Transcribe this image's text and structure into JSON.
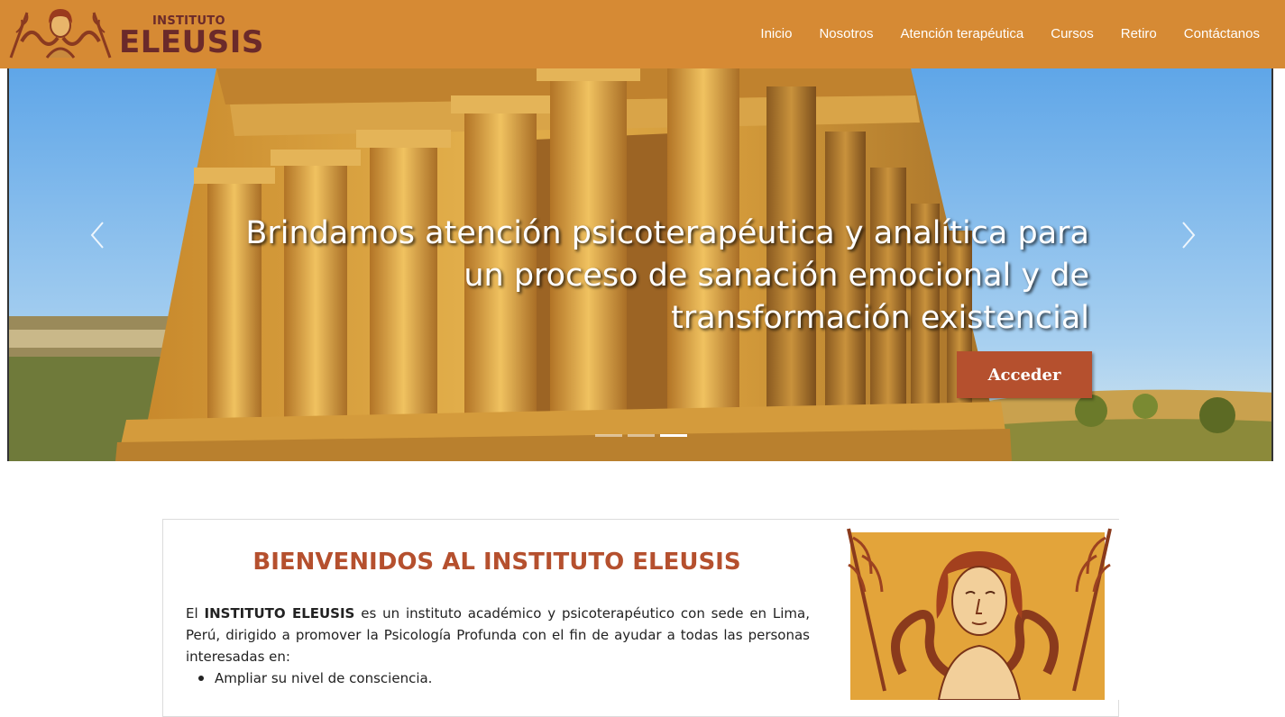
{
  "brand": {
    "small_text": "INSTITUTO",
    "big_text": "ELEUSIS"
  },
  "nav": {
    "items": [
      {
        "label": "Inicio"
      },
      {
        "label": "Nosotros"
      },
      {
        "label": "Atención terapéutica"
      },
      {
        "label": "Cursos"
      },
      {
        "label": "Retiro"
      },
      {
        "label": "Contáctanos"
      }
    ]
  },
  "hero": {
    "caption_line1": "Brindamos atención psicoterapéutica y analítica para",
    "caption_line2": "un proceso de sanación emocional y de",
    "caption_line3": "transformación existencial",
    "button_label": "Acceder",
    "prev_icon": "chevron-left-icon",
    "next_icon": "chevron-right-icon",
    "slides_total": 3,
    "active_slide": 3
  },
  "welcome": {
    "title": "BIENVENIDOS AL INSTITUTO ELEUSIS",
    "intro_prefix": "El ",
    "intro_bold": "INSTITUTO ELEUSIS",
    "intro_rest": " es un instituto académico y psicoterapéutico con sede en Lima, Perú, dirigido a promover la Psicología Profunda con el fin de ayudar a todas las personas interesadas en:",
    "bullets": [
      "Ampliar su nivel de consciencia."
    ]
  },
  "colors": {
    "navbar": "#d68a34",
    "brand_text": "#6b2a2a",
    "accent": "#b5502e"
  }
}
